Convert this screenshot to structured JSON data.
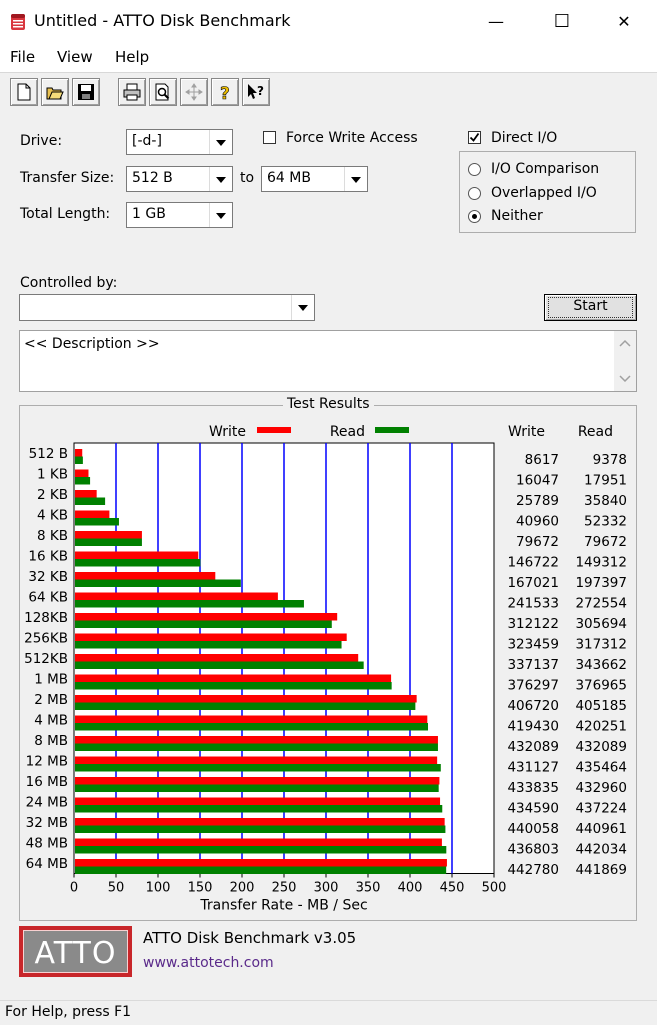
{
  "window": {
    "title": "Untitled - ATTO Disk Benchmark",
    "minimize_glyph": "—",
    "maximize_glyph": "☐",
    "close_glyph": "✕"
  },
  "menu": [
    "File",
    "View",
    "Help"
  ],
  "toolbar": {
    "icons": [
      "new-icon",
      "open-icon",
      "save-icon",
      "print-icon",
      "print-preview-icon",
      "move-icon",
      "help-icon",
      "context-help-icon"
    ]
  },
  "form": {
    "drive_label": "Drive:",
    "drive_value": "[-d-]",
    "force_write_label": "Force Write Access",
    "force_write_checked": false,
    "direct_io_label": "Direct I/O",
    "direct_io_checked": true,
    "transfer_size_label": "Transfer Size:",
    "transfer_from": "512 B",
    "to_label": "to",
    "transfer_to": "64 MB",
    "total_length_label": "Total Length:",
    "total_length_value": "1 GB",
    "radio_io_comparison": "I/O Comparison",
    "radio_overlapped": "Overlapped I/O",
    "radio_neither": "Neither",
    "radio_selected": "neither",
    "controlled_by_label": "Controlled by:",
    "controlled_by_value": "",
    "start_label": "Start",
    "description": "<< Description >>"
  },
  "results": {
    "group_title": "Test Results",
    "write_col": "Write",
    "read_col": "Read"
  },
  "chart_data": {
    "type": "bar",
    "orientation": "horizontal",
    "categories": [
      "512 B",
      "1 KB",
      "2 KB",
      "4 KB",
      "8 KB",
      "16 KB",
      "32 KB",
      "64 KB",
      "128KB",
      "256KB",
      "512KB",
      "1 MB",
      "2 MB",
      "4 MB",
      "8 MB",
      "12 MB",
      "16 MB",
      "24 MB",
      "32 MB",
      "48 MB",
      "64 MB"
    ],
    "series": [
      {
        "name": "Write",
        "color": "#ff0000",
        "values": [
          8617,
          16047,
          25789,
          40960,
          79672,
          146722,
          167021,
          241533,
          312122,
          323459,
          337137,
          376297,
          406720,
          419430,
          432089,
          431127,
          433835,
          434590,
          440058,
          436803,
          442780
        ]
      },
      {
        "name": "Read",
        "color": "#008000",
        "values": [
          9378,
          17951,
          35840,
          52332,
          79672,
          149312,
          197397,
          272554,
          305694,
          317312,
          343662,
          376965,
          405185,
          420251,
          432089,
          435464,
          432960,
          437224,
          440961,
          442034,
          441869
        ]
      }
    ],
    "xlabel": "Transfer Rate - MB / Sec",
    "xlim": [
      0,
      500
    ],
    "xticks": [
      0,
      50,
      100,
      150,
      200,
      250,
      300,
      350,
      400,
      450,
      500
    ],
    "units_divisor": 1000,
    "grid": true,
    "grid_color": "#0000ff",
    "legend_placement": "top"
  },
  "footer": {
    "logo_text": "ATTO",
    "product": "ATTO Disk Benchmark v3.05",
    "url": "www.attotech.com"
  },
  "status": "For Help, press F1"
}
